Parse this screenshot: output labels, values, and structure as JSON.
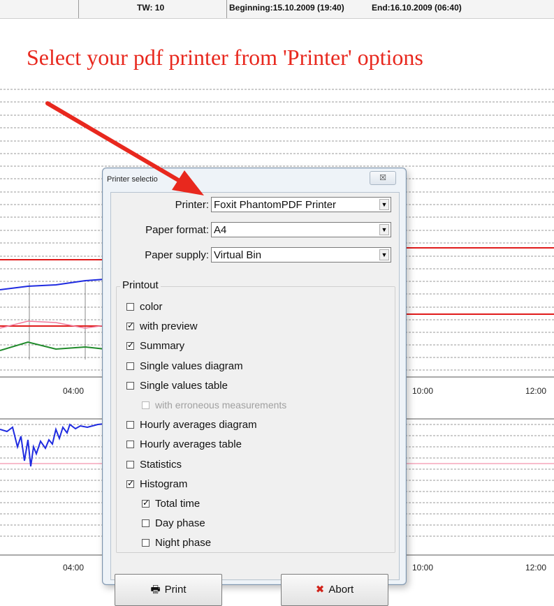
{
  "header": {
    "tw": "TW: 10",
    "beginning": "Beginning:15.10.2009 (19:40)",
    "end": "End:16.10.2009 (06:40)"
  },
  "annotation": {
    "text": "Select your pdf printer from 'Printer' options",
    "color": "#e8281e"
  },
  "chart_data": {
    "type": "line",
    "x_ticks_top": [
      "04:00",
      "10:00",
      "12:00"
    ],
    "x_ticks_bottom": [
      "04:00",
      "10:00",
      "12:00"
    ],
    "colors": {
      "blue": "#1f2be0",
      "red": "#e01b1b",
      "pink": "#f07a9a",
      "green": "#1f8a2a"
    }
  },
  "dialog": {
    "title": "Printer selectio",
    "close_label": "☒",
    "printer_label": "Printer:",
    "printer_value": "Foxit PhantomPDF Printer",
    "paper_format_label": "Paper format:",
    "paper_format_value": "A4",
    "paper_supply_label": "Paper supply:",
    "paper_supply_value": "Virtual Bin",
    "printout_label": "Printout",
    "options": [
      {
        "label": "color",
        "checked": false
      },
      {
        "label": "with preview",
        "checked": true
      },
      {
        "label": "Summary",
        "checked": true
      },
      {
        "label": "Single values diagram",
        "checked": false
      },
      {
        "label": "Single values table",
        "checked": false
      },
      {
        "label": "with erroneous measurements",
        "checked": false,
        "disabled": true
      },
      {
        "label": "Hourly averages diagram",
        "checked": false
      },
      {
        "label": "Hourly averages table",
        "checked": false
      },
      {
        "label": "Statistics",
        "checked": false
      },
      {
        "label": "Histogram",
        "checked": true
      },
      {
        "label": "Total time",
        "checked": true
      },
      {
        "label": "Day phase",
        "checked": false
      },
      {
        "label": "Night phase",
        "checked": false
      }
    ],
    "print_label": "Print",
    "abort_label": "Abort"
  }
}
